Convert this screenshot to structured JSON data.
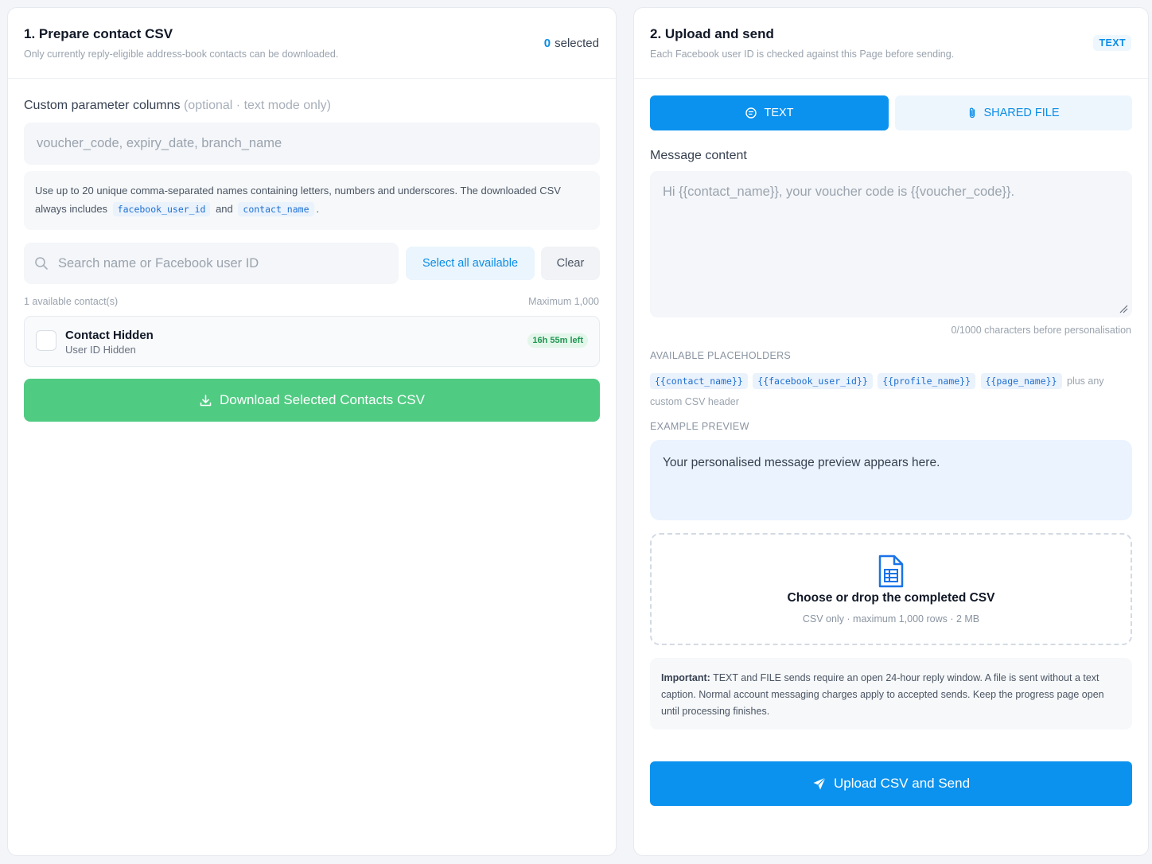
{
  "prepare": {
    "title": "1. Prepare contact CSV",
    "subtitle": "Only currently reply-eligible address-book contacts can be downloaded.",
    "selected_num": "0",
    "selected_label": "selected",
    "custom_label": "Custom parameter columns",
    "custom_label_hint": "(optional · text mode only)",
    "custom_placeholder": "voucher_code, expiry_date, branch_name",
    "help_text": "Use up to 20 unique comma-separated names containing letters, numbers and underscores. The downloaded CSV always includes",
    "help_code_1": "facebook_user_id",
    "help_and": "and",
    "help_code_2": "contact_name",
    "help_end": ".",
    "search_placeholder": "Search name or Facebook user ID",
    "select_all_label": "Select all available",
    "clear_label": "Clear",
    "available_count": "1 available contact(s)",
    "maximum": "Maximum 1,000",
    "contacts": [
      {
        "name": "Contact Hidden",
        "user_id": "User ID Hidden",
        "time_left": "16h 55m left"
      }
    ],
    "download_label": "Download Selected Contacts CSV"
  },
  "upload": {
    "title": "2. Upload and send",
    "subtitle": "Each Facebook user ID is checked against this Page before sending.",
    "mode_badge": "TEXT",
    "tab_text": "TEXT",
    "tab_file": "SHARED FILE",
    "message_label": "Message content",
    "message_placeholder": "Hi {{contact_name}}, your voucher code is {{voucher_code}}.",
    "char_count": "0/1000 characters before personalisation",
    "placeholders_caption": "AVAILABLE PLACEHOLDERS",
    "placeholders": [
      "{{contact_name}}",
      "{{facebook_user_id}}",
      "{{profile_name}}",
      "{{page_name}}"
    ],
    "placeholders_suffix": "plus any custom CSV header",
    "preview_caption": "EXAMPLE PREVIEW",
    "preview_text": "Your personalised message preview appears here.",
    "drop_title": "Choose or drop the completed CSV",
    "drop_sub": "CSV only · maximum 1,000 rows · 2 MB",
    "important_label": "Important:",
    "important_text": "TEXT and FILE sends require an open 24-hour reply window. A file is sent without a text caption. Normal account messaging charges apply to accepted sends. Keep the progress page open until processing finishes.",
    "upload_button": "Upload CSV and Send"
  },
  "colors": {
    "primary": "#0b92ee",
    "success": "#4fcb82",
    "badge_green": "#219653"
  }
}
